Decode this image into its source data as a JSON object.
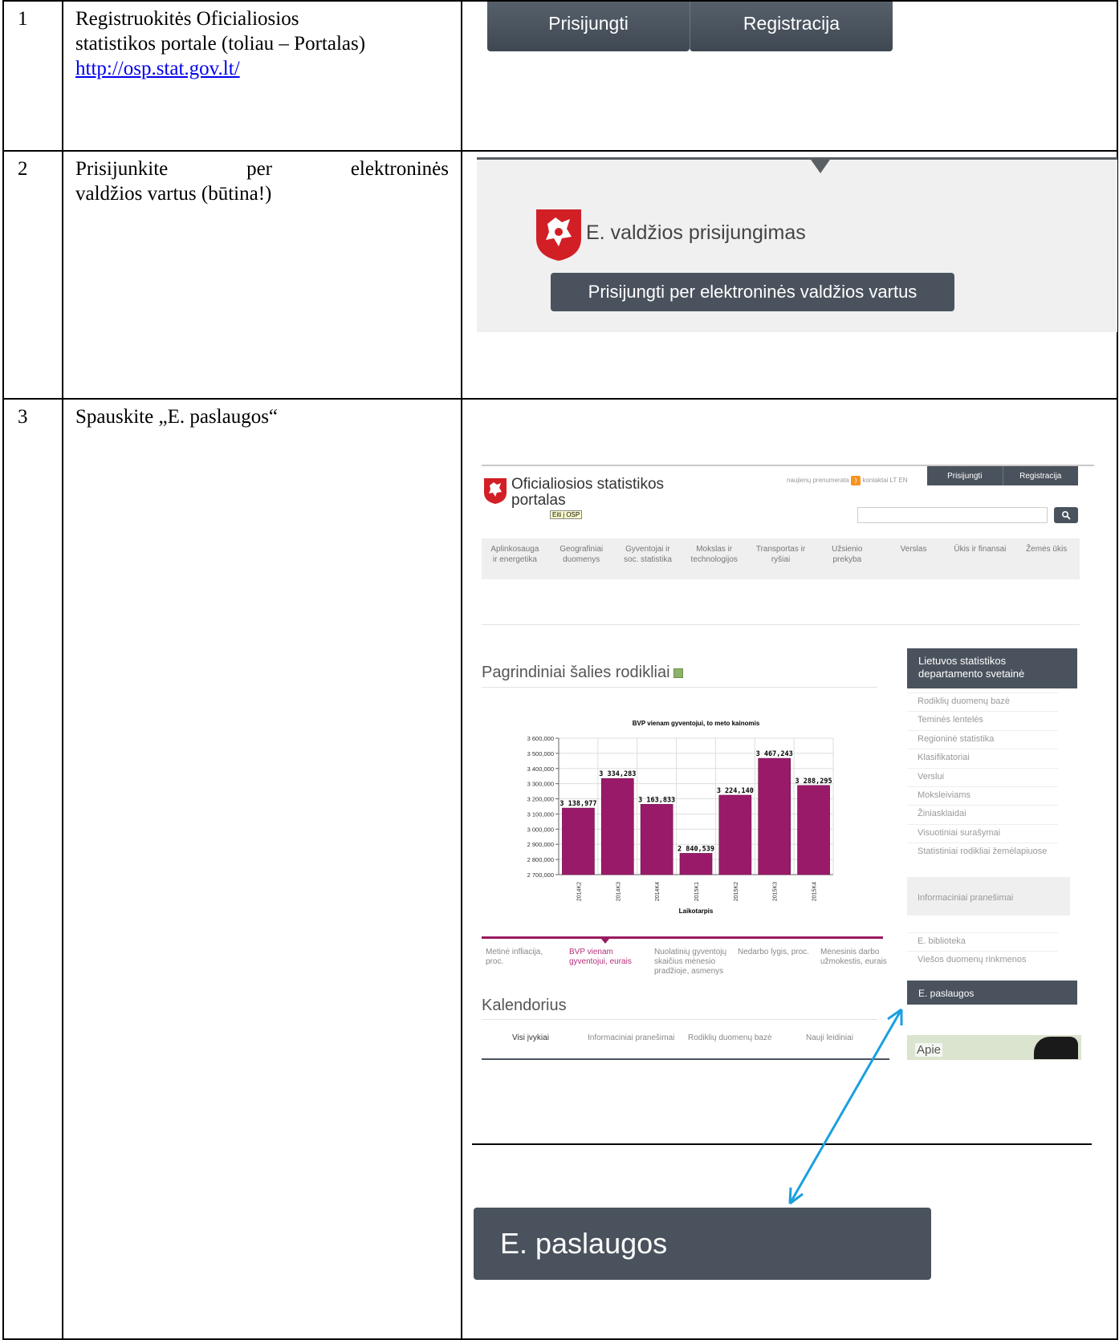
{
  "rows": [
    {
      "number": "1",
      "text_lines": [
        "Registruokitės Oficialiosios",
        "statistikos portale (toliau – Portalas)"
      ],
      "link": "http://osp.stat.gov.lt/",
      "screenshot": {
        "buttons": [
          "Prisijungti",
          "Registracija"
        ]
      }
    },
    {
      "number": "2",
      "text_lines": [
        "Prisijunkite per elektroninės",
        "valdžios vartus (būtina!)"
      ],
      "screenshot": {
        "title": "E. valdžios prisijungimas",
        "button": "Prisijungti per elektroninės valdžios vartus"
      }
    },
    {
      "number": "3",
      "text_lines": [
        "Spauskite „E. paslaugos“"
      ],
      "screenshot": {
        "portal_title_line1": "Oficialiosios statistikos",
        "portal_title_line2": "portalas",
        "tooltip": "Eiti į OSP",
        "top_links": "naujienų prenumerata",
        "top_links_2": "kontaktai  LT  EN",
        "top_buttons": [
          "Prisijungti",
          "Registracija"
        ],
        "search_icon": "search-icon",
        "nav": [
          [
            "Aplinkosauga",
            "ir energetika"
          ],
          [
            "Geografiniai",
            "duomenys"
          ],
          [
            "Gyventojai ir",
            "soc. statistika"
          ],
          [
            "Mokslas ir",
            "technologijos"
          ],
          [
            "Transportas ir",
            "ryšiai"
          ],
          [
            "Užsienio",
            "prekyba"
          ],
          [
            "Verslas",
            ""
          ],
          [
            "Ūkis ir finansai",
            ""
          ],
          [
            "Žemės ūkis",
            ""
          ]
        ],
        "heading": "Pagrindiniai šalies rodikliai",
        "tabs": [
          [
            "Metinė infliacija,",
            "proc."
          ],
          [
            "BVP vienam",
            "gyventojui, eurais"
          ],
          [
            "Nuolatinių gyventojų",
            "skaičius mėnesio",
            "pradžioje, asmenys"
          ],
          [
            "Nedarbo lygis, proc.",
            ""
          ],
          [
            "Mėnesinis darbo",
            "užmokestis, eurais"
          ]
        ],
        "calendar_title": "Kalendorius",
        "calendar_tabs": [
          "Visi įvykiai",
          "Informaciniai pranešimai",
          "Rodiklių duomenų bazė",
          "Nauji leidiniai"
        ],
        "sidebar_head": [
          "Lietuvos statistikos",
          "departamento svetainė"
        ],
        "sidebar_items": [
          "Rodiklių duomenų bazė",
          "Teminės lentelės",
          "Regioninė statistika",
          "Klasifikatoriai",
          "Verslui",
          "Moksleiviams",
          "Žiniasklaidai",
          "Visuotiniai surašymai",
          "Statistiniai rodikliai žemėlapiuose"
        ],
        "sidebar_box": "Informaciniai pranešimai",
        "sidebar_items_2": [
          "E. biblioteka",
          "Viešos duomenų rinkmenos"
        ],
        "eservices": "E. paslaugos",
        "map_text": "Apie",
        "zoom_button": "E. paslaugos"
      }
    }
  ],
  "chart_data": {
    "type": "bar",
    "title": "BVP vienam gyventojui, to meto kainomis",
    "xlabel": "Laikotarpis",
    "ylabel": "",
    "categories": [
      "2014K2",
      "2014K3",
      "2014K4",
      "2015K1",
      "2015K2",
      "2015K3",
      "2015K4"
    ],
    "values": [
      3138977,
      3334283,
      3163833,
      2840539,
      3224140,
      3467243,
      3288295
    ],
    "value_labels": [
      "3 138,977",
      "3 334,283",
      "3 163,833",
      "2 840,539",
      "3 224,140",
      "3 467,243",
      "3 288,295"
    ],
    "ylim": [
      2700000,
      3600000
    ],
    "yticks": [
      2700000,
      2800000,
      2900000,
      3000000,
      3100000,
      3200000,
      3300000,
      3400000,
      3500000,
      3600000
    ],
    "ytick_labels": [
      "2 700,000",
      "2 800,000",
      "2 900,000",
      "3 000,000",
      "3 100,000",
      "3 200,000",
      "3 300,000",
      "3 400,000",
      "3 500,000",
      "3 600,000"
    ],
    "bar_color": "#9a1a6a",
    "grid": true
  }
}
